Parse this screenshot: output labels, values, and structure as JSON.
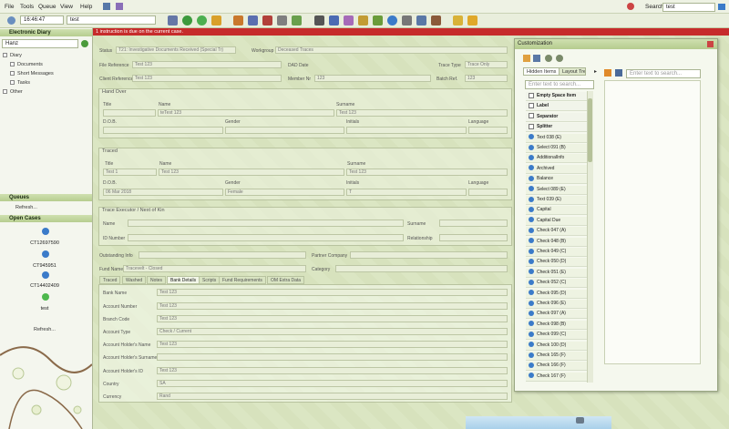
{
  "menu": [
    "File",
    "Tools",
    "Queue",
    "View",
    "Help"
  ],
  "toolbar": {
    "time": "16:46:47",
    "entity": "test",
    "search_label": "Search",
    "search_value": "test"
  },
  "alert": "1 instruction is due on the current case.",
  "left": {
    "title": "Electronic Diary",
    "user": "Hanz",
    "tree": [
      {
        "label": "Diary",
        "level": 0
      },
      {
        "label": "Documents",
        "level": 1
      },
      {
        "label": "Short Messages",
        "level": 1
      },
      {
        "label": "Tasks",
        "level": 1
      },
      {
        "label": "Other",
        "level": 0
      }
    ],
    "queues_title": "Queues",
    "refresh": "Refresh...",
    "open_cases_title": "Open Cases",
    "cases": [
      {
        "label": "CT12697590",
        "color": "#3b7bc9"
      },
      {
        "label": "CT945951",
        "color": "#3b7bc9"
      },
      {
        "label": "CT14402409",
        "color": "#3b7bc9"
      },
      {
        "label": "test",
        "color": "#4db84d"
      }
    ],
    "refresh2": "Refresh..."
  },
  "form": {
    "status_label": "Status",
    "status_value": "T21: Investigative Documents Received (Special Tr)",
    "workgroup_label": "Workgroup",
    "workgroup_value": "Deceased Traces",
    "file_ref_label": "File Reference",
    "file_ref_value": "Test 123",
    "dad_label": "DAD Date",
    "trace_type_label": "Trace Type",
    "trace_type_value": "Trace Only",
    "client_ref_label": "Client Reference",
    "client_ref_value": "Test 123",
    "member_label": "Member Nr",
    "member_value": "123",
    "batch_label": "Batch Ref.",
    "batch_value": "123",
    "handover": "Hand Over",
    "title_lbl": "Title",
    "name_lbl": "Name",
    "surname_lbl": "Surname",
    "name_val": "teTest 123",
    "surname_val": "Test 123",
    "dob_lbl": "D.O.B.",
    "gender_lbl": "Gender",
    "initials_lbl": "Initials",
    "language_lbl": "Language",
    "traced": "Traced",
    "tr_title": "Test 1",
    "tr_name": "Test 123",
    "tr_surname": "Test 123",
    "tr_dob": "06 Mar 2018",
    "tr_gender": "Female",
    "tr_initials": "T",
    "executor": "Trace Executor / Next of Kin",
    "ex_name_lbl": "Name",
    "ex_surname_lbl": "Surname",
    "ex_id_lbl": "ID Number",
    "ex_rel_lbl": "Relationship",
    "outstanding_lbl": "Outstanding Info",
    "partner_lbl": "Partner Company",
    "fund_lbl": "Fund Name",
    "fund_val": "Tracevelt - Closed",
    "category_lbl": "Category",
    "tabs": [
      "Traced",
      "Washed",
      "Notes",
      "Bank Details",
      "Scripts",
      "Fund Requirements",
      "OM Extra Data"
    ],
    "bank": [
      {
        "label": "Bank Name",
        "value": "Test 123"
      },
      {
        "label": "Account Number",
        "value": "Test 123"
      },
      {
        "label": "Branch Code",
        "value": "Test 123"
      },
      {
        "label": "Account Type",
        "value": "Check / Current"
      },
      {
        "label": "Account Holder's Name",
        "value": "Test 123"
      },
      {
        "label": "Account Holder's Surname",
        "value": ""
      },
      {
        "label": "Account Holder's ID",
        "value": "Test 123"
      },
      {
        "label": "Country",
        "value": "SA"
      },
      {
        "label": "Currency",
        "value": "Rand"
      }
    ]
  },
  "customization": {
    "title": "Customization",
    "tab1": "Hidden Items",
    "tab2": "Layout Tree",
    "placeholder": "Enter text to search...",
    "items": [
      {
        "label": "Empty Space Item",
        "bold": true
      },
      {
        "label": "Label",
        "bold": true
      },
      {
        "label": "Separator",
        "bold": true
      },
      {
        "label": "Splitter",
        "bold": true
      },
      {
        "label": "Text 038 (E)"
      },
      {
        "label": "Select 091 (B)"
      },
      {
        "label": "AdditionalInfo"
      },
      {
        "label": "Archived"
      },
      {
        "label": "Balance"
      },
      {
        "label": "Select 089 (E)"
      },
      {
        "label": "Text 039 (E)"
      },
      {
        "label": "Capital"
      },
      {
        "label": "Capital Due"
      },
      {
        "label": "Check 047 (A)"
      },
      {
        "label": "Check 048 (B)"
      },
      {
        "label": "Check 049 (C)"
      },
      {
        "label": "Check 050 (D)"
      },
      {
        "label": "Check 051 (E)"
      },
      {
        "label": "Check 052 (C)"
      },
      {
        "label": "Check 095 (D)"
      },
      {
        "label": "Check 096 (E)"
      },
      {
        "label": "Check 097 (A)"
      },
      {
        "label": "Check 098 (B)"
      },
      {
        "label": "Check 099 (C)"
      },
      {
        "label": "Check 100 (D)"
      },
      {
        "label": "Check 165 (F)"
      },
      {
        "label": "Check 166 (F)"
      },
      {
        "label": "Check 167 (F)"
      }
    ]
  }
}
